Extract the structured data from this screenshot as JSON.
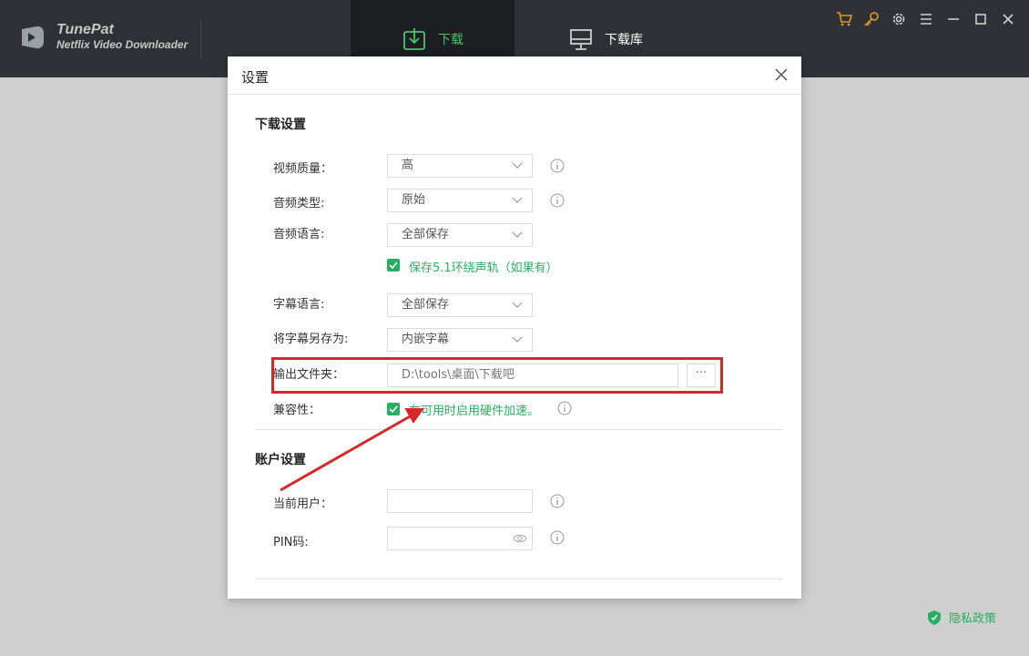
{
  "app": {
    "name": "TunePat",
    "subtitle": "Netflix Video Downloader"
  },
  "tabs": [
    {
      "label": "下载",
      "icon": "download-icon",
      "active": true
    },
    {
      "label": "下载库",
      "icon": "monitor-icon",
      "active": false
    }
  ],
  "window_controls": [
    "cart-icon",
    "key-icon",
    "gear-icon",
    "menu-icon",
    "minimize-icon",
    "maximize-icon",
    "close-icon"
  ],
  "dialog": {
    "title": "设置",
    "download_section": {
      "title": "下载设置",
      "video_quality": {
        "label": "视频质量：",
        "value": "高"
      },
      "audio_type": {
        "label": "音频类型:",
        "value": "原始"
      },
      "audio_language": {
        "label": "音频语言:",
        "value": "全部保存"
      },
      "keep_surround": {
        "label": "保存5.1环绕声轨（如果有）",
        "checked": true
      },
      "subtitle_language": {
        "label": "字幕语言:",
        "value": "全部保存"
      },
      "save_subtitle_as": {
        "label": "将字幕另存为:",
        "value": "内嵌字幕"
      },
      "output_folder": {
        "label": "输出文件夹：",
        "value": "D:\\tools\\桌面\\下载吧",
        "browse": "···"
      },
      "compatibility": {
        "label": "兼容性：",
        "option": "在可用时启用硬件加速。",
        "checked": true
      }
    },
    "account_section": {
      "title": "账户设置",
      "current_user": {
        "label": "当前用户：",
        "value": ""
      },
      "pin": {
        "label": "PIN码:",
        "value": ""
      }
    }
  },
  "footer": {
    "privacy": "隐私政策"
  },
  "colors": {
    "accent_green": "#27ae60",
    "titlebar": "#2f3136",
    "highlight_red": "#d9262b"
  }
}
